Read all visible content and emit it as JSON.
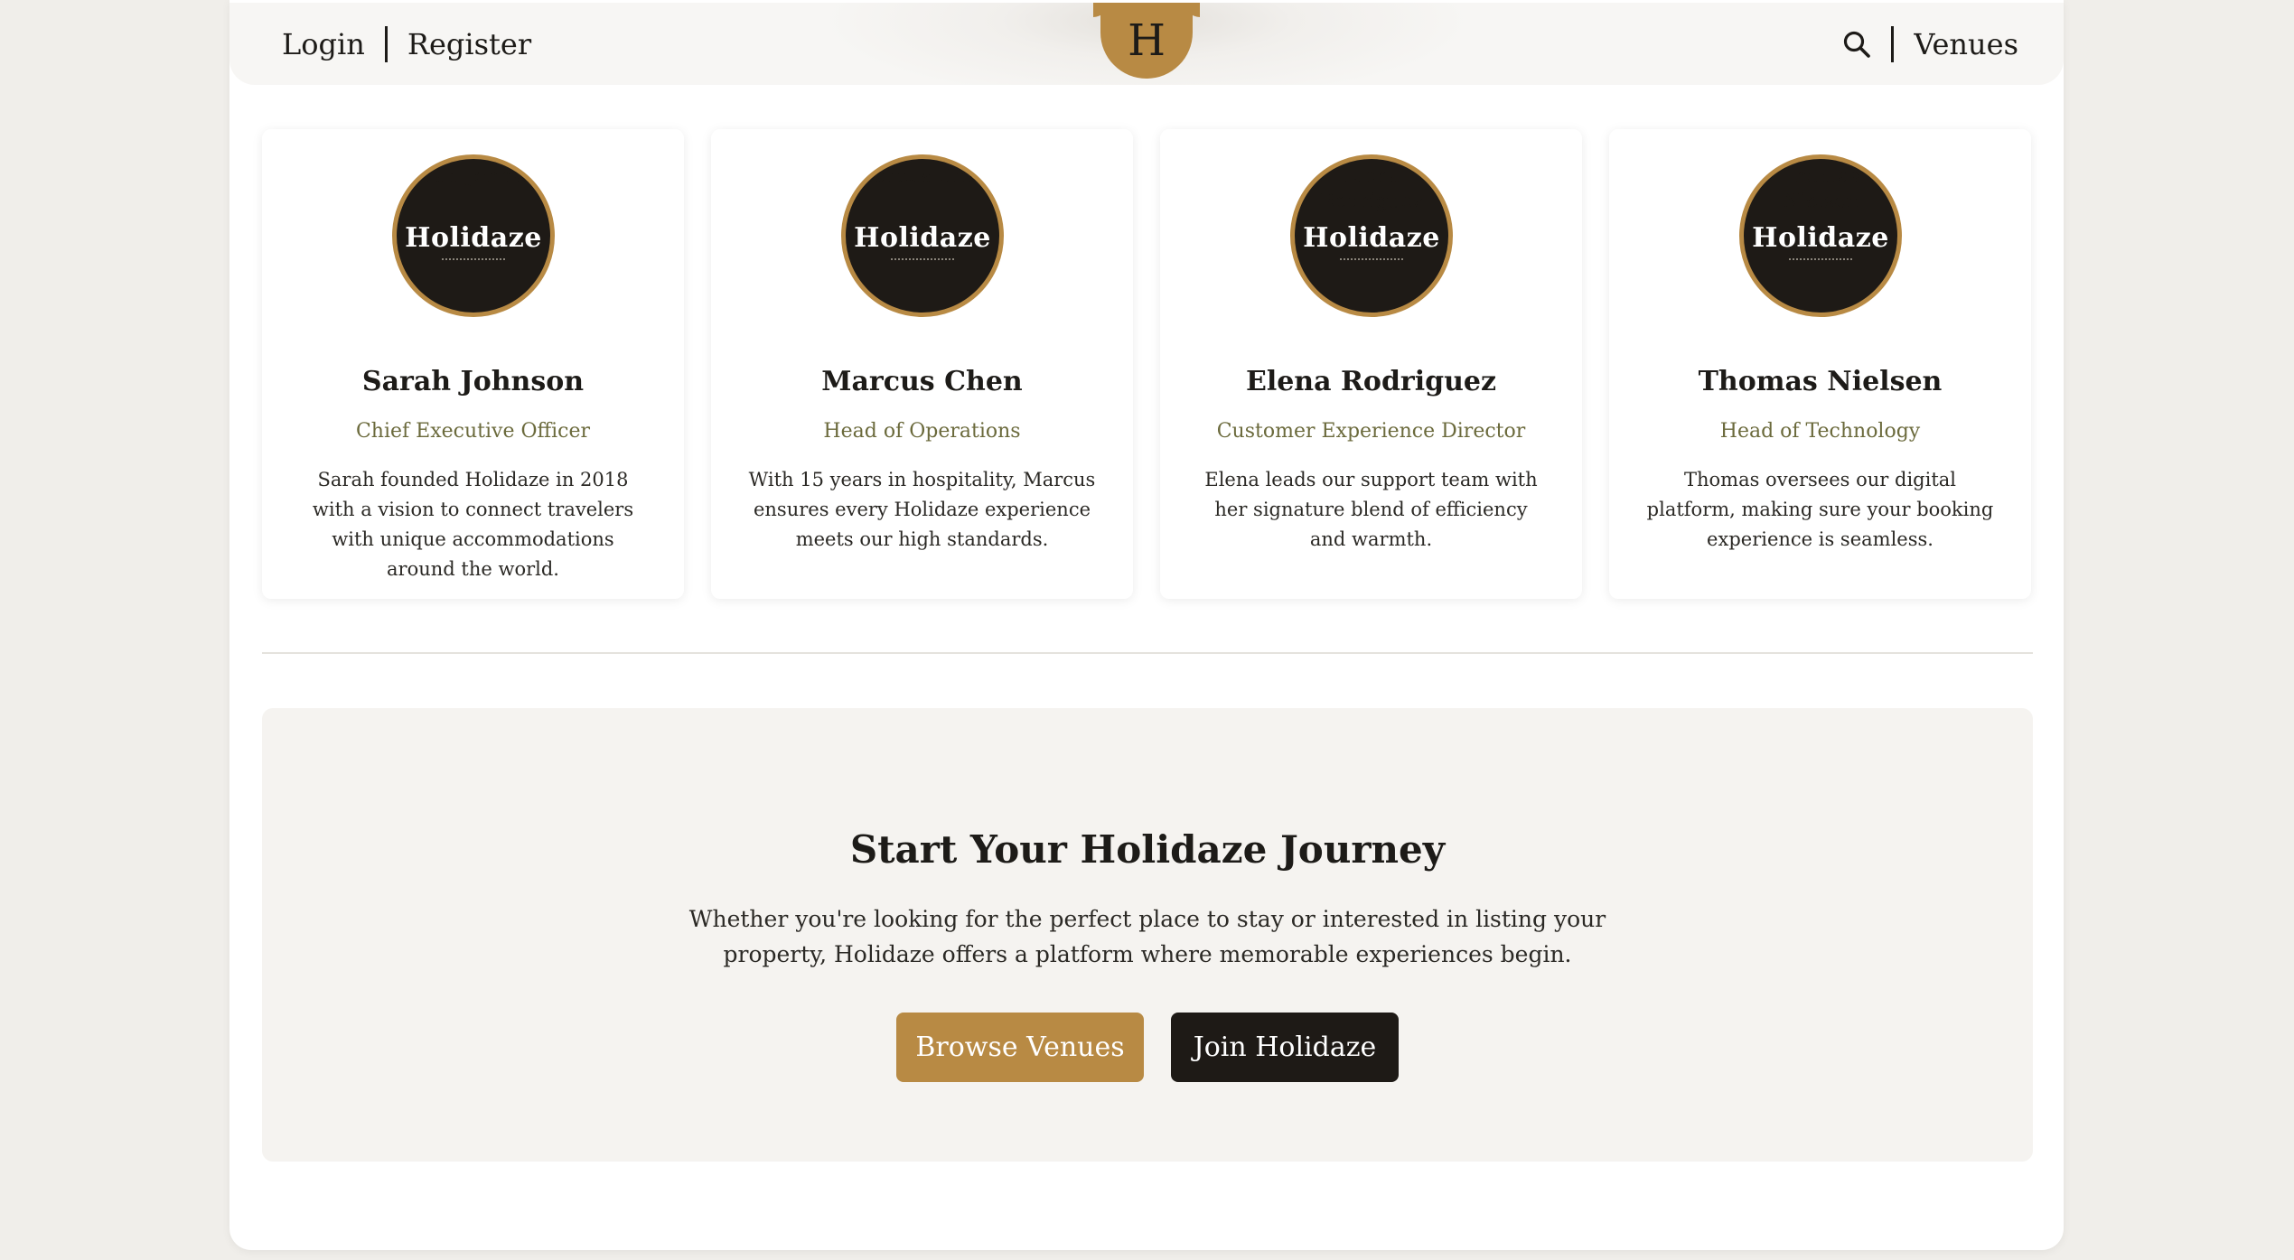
{
  "header": {
    "login_label": "Login",
    "register_label": "Register",
    "logo_letter": "H",
    "venues_label": "Venues",
    "search_icon": "search-icon"
  },
  "team": [
    {
      "avatar_alt": "Sarah Johnson",
      "avatar_brand": "Holidaze",
      "name": "Sarah Johnson",
      "role": "Chief Executive Officer",
      "bio": "Sarah founded Holidaze in 2018 with a vision to connect travelers with unique accommodations around the world."
    },
    {
      "avatar_alt": "Marcus Chen",
      "avatar_brand": "Holidaze",
      "name": "Marcus Chen",
      "role": "Head of Operations",
      "bio": "With 15 years in hospitality, Marcus ensures every Holidaze experience meets our high standards."
    },
    {
      "avatar_alt": "Elena Rodriguez",
      "avatar_brand": "Holidaze",
      "name": "Elena Rodriguez",
      "role": "Customer Experience Director",
      "bio": "Elena leads our support team with her signature blend of efficiency and warmth."
    },
    {
      "avatar_alt": "Thomas Nielsen",
      "avatar_brand": "Holidaze",
      "name": "Thomas Nielsen",
      "role": "Head of Technology",
      "bio": "Thomas oversees our digital platform, making sure your booking experience is seamless."
    }
  ],
  "cta": {
    "title": "Start Your Holidaze Journey",
    "text": "Whether you're looking for the perfect place to stay or interested in listing your property, Holidaze offers a platform where memorable experiences begin.",
    "browse_label": "Browse Venues",
    "join_label": "Join Holidaze"
  },
  "colors": {
    "accent": "#b88a44",
    "dark": "#1e1a16",
    "role_text": "#6b6a3c",
    "page_bg": "#f0eeea"
  }
}
